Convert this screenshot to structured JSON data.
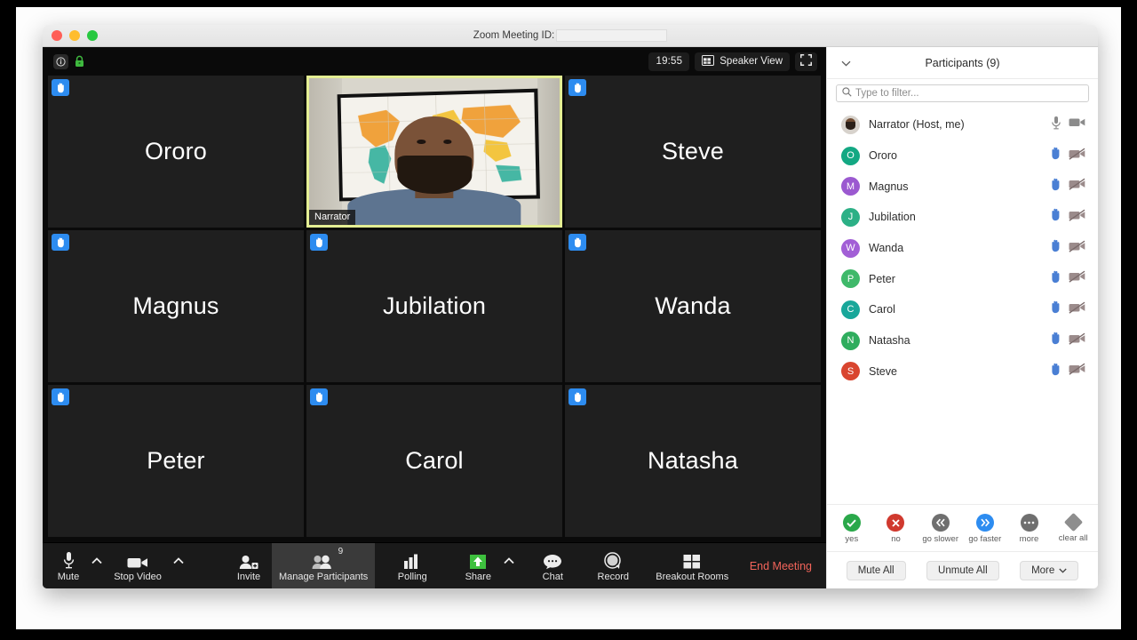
{
  "window": {
    "title_prefix": "Zoom Meeting ID:",
    "meeting_id_value": ""
  },
  "meeting_topbar": {
    "info_icon": "info-icon",
    "lock_icon": "lock-icon",
    "timer": "19:55",
    "view_mode": "Speaker View",
    "view_icon": "grid-view-icon",
    "fullscreen_icon": "enter-fullscreen-icon"
  },
  "grid": {
    "tiles": [
      {
        "name": "Ororo",
        "hand_raised": true,
        "video_on": false,
        "active_speaker": false
      },
      {
        "name": "Narrator",
        "hand_raised": false,
        "video_on": true,
        "active_speaker": true
      },
      {
        "name": "Steve",
        "hand_raised": true,
        "video_on": false,
        "active_speaker": false
      },
      {
        "name": "Magnus",
        "hand_raised": true,
        "video_on": false,
        "active_speaker": false
      },
      {
        "name": "Jubilation",
        "hand_raised": true,
        "video_on": false,
        "active_speaker": false
      },
      {
        "name": "Wanda",
        "hand_raised": true,
        "video_on": false,
        "active_speaker": false
      },
      {
        "name": "Peter",
        "hand_raised": true,
        "video_on": false,
        "active_speaker": false
      },
      {
        "name": "Carol",
        "hand_raised": true,
        "video_on": false,
        "active_speaker": false
      },
      {
        "name": "Natasha",
        "hand_raised": true,
        "video_on": false,
        "active_speaker": false
      }
    ]
  },
  "controlbar": {
    "mute": {
      "label": "Mute",
      "icon": "microphone-icon"
    },
    "stop_video": {
      "label": "Stop Video",
      "icon": "camera-icon"
    },
    "invite": {
      "label": "Invite",
      "icon": "person-add-icon"
    },
    "manage_participants": {
      "label": "Manage Participants",
      "icon": "people-icon",
      "count": "9",
      "selected": true
    },
    "polling": {
      "label": "Polling",
      "icon": "bar-chart-icon"
    },
    "share": {
      "label": "Share",
      "icon": "share-screen-icon",
      "color": "#3ec03e"
    },
    "chat": {
      "label": "Chat",
      "icon": "chat-bubble-icon"
    },
    "record": {
      "label": "Record",
      "icon": "record-circle-icon"
    },
    "breakout_rooms": {
      "label": "Breakout Rooms",
      "icon": "four-squares-icon"
    },
    "end_meeting": {
      "label": "End Meeting",
      "color": "#f2645a"
    }
  },
  "panel": {
    "title": "Participants (9)",
    "collapse_icon": "chevron-down-icon",
    "search": {
      "placeholder": "Type to filter...",
      "value": "",
      "icon": "search-icon"
    },
    "participants": [
      {
        "name": "Narrator (Host, me)",
        "initial": "",
        "avatar_color": "#d7d2cc",
        "is_photo": true,
        "mic_icon": "microphone-icon",
        "video_icon": "camera-icon",
        "state": "self"
      },
      {
        "name": "Ororo",
        "initial": "O",
        "avatar_color": "#13a883",
        "is_photo": false,
        "mic_icon": "raised-hand-icon",
        "video_icon": "camera-off-icon",
        "state": "hand"
      },
      {
        "name": "Magnus",
        "initial": "M",
        "avatar_color": "#9b59d0",
        "is_photo": false,
        "mic_icon": "raised-hand-icon",
        "video_icon": "camera-off-icon",
        "state": "hand"
      },
      {
        "name": "Jubilation",
        "initial": "J",
        "avatar_color": "#2cb086",
        "is_photo": false,
        "mic_icon": "raised-hand-icon",
        "video_icon": "camera-off-icon",
        "state": "hand"
      },
      {
        "name": "Wanda",
        "initial": "W",
        "avatar_color": "#a25fd6",
        "is_photo": false,
        "mic_icon": "raised-hand-icon",
        "video_icon": "camera-off-icon",
        "state": "hand"
      },
      {
        "name": "Peter",
        "initial": "P",
        "avatar_color": "#3fb96a",
        "is_photo": false,
        "mic_icon": "raised-hand-icon",
        "video_icon": "camera-off-icon",
        "state": "hand"
      },
      {
        "name": "Carol",
        "initial": "C",
        "avatar_color": "#18a79a",
        "is_photo": false,
        "mic_icon": "raised-hand-icon",
        "video_icon": "camera-off-icon",
        "state": "hand"
      },
      {
        "name": "Natasha",
        "initial": "N",
        "avatar_color": "#2fad5e",
        "is_photo": false,
        "mic_icon": "raised-hand-icon",
        "video_icon": "camera-off-icon",
        "state": "hand"
      },
      {
        "name": "Steve",
        "initial": "S",
        "avatar_color": "#d9452f",
        "is_photo": false,
        "mic_icon": "raised-hand-icon",
        "video_icon": "camera-off-icon",
        "state": "hand"
      }
    ],
    "reactions": [
      {
        "label": "yes",
        "icon": "check-circle-icon",
        "color": "#2aa84a",
        "glyph": "✓"
      },
      {
        "label": "no",
        "icon": "x-circle-icon",
        "color": "#d0392e",
        "glyph": "✕"
      },
      {
        "label": "go slower",
        "icon": "rewind-circle-icon",
        "color": "#6f6f6f",
        "glyph": "«"
      },
      {
        "label": "go faster",
        "icon": "forward-circle-icon",
        "color": "#2d8cf0",
        "glyph": "»"
      },
      {
        "label": "more",
        "icon": "ellipsis-circle-icon",
        "color": "#6f6f6f",
        "glyph": "•••"
      },
      {
        "label": "clear all",
        "icon": "clear-all-icon",
        "color": "#8e8e8e",
        "glyph": ""
      }
    ],
    "footer": {
      "mute_all": "Mute All",
      "unmute_all": "Unmute All",
      "more": "More",
      "more_icon": "chevron-down-icon"
    }
  }
}
